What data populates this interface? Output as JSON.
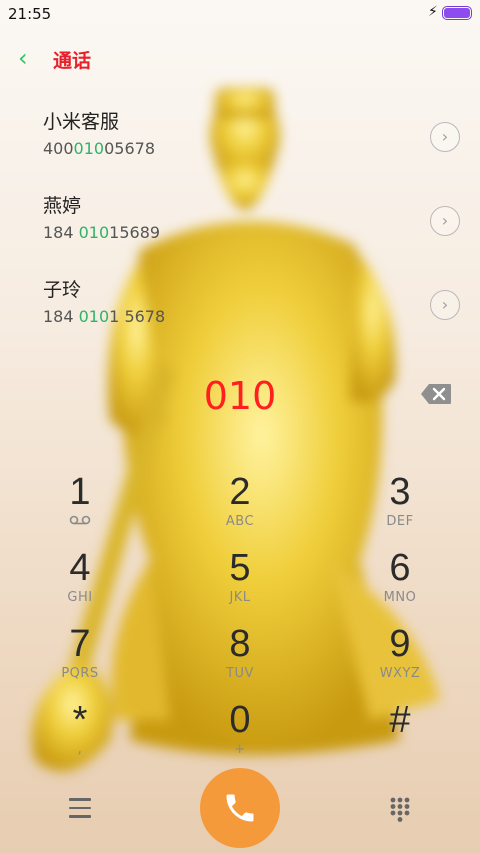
{
  "status": {
    "time": "21:55",
    "charging_icon": "bolt-icon",
    "battery_color": "#8e4cf0"
  },
  "header": {
    "title": "通话",
    "back_icon": "chevron-left-icon"
  },
  "contacts": [
    {
      "name": "小米客服",
      "number_pre": "400",
      "number_match": "010",
      "number_post": "05678"
    },
    {
      "name": "燕婷",
      "number_pre": "184 ",
      "number_match": "010",
      "number_post": "15689"
    },
    {
      "name": "子玲",
      "number_pre": "184 ",
      "number_match": "010",
      "number_post": "1 5678"
    }
  ],
  "dialed": "010",
  "keypad": [
    {
      "digit": "1",
      "letters": "voicemail-icon"
    },
    {
      "digit": "2",
      "letters": "ABC"
    },
    {
      "digit": "3",
      "letters": "DEF"
    },
    {
      "digit": "4",
      "letters": "GHI"
    },
    {
      "digit": "5",
      "letters": "JKL"
    },
    {
      "digit": "6",
      "letters": "MNO"
    },
    {
      "digit": "7",
      "letters": "PQRS"
    },
    {
      "digit": "8",
      "letters": "TUV"
    },
    {
      "digit": "9",
      "letters": "WXYZ"
    },
    {
      "digit": "*",
      "letters": ","
    },
    {
      "digit": "0",
      "letters": "+"
    },
    {
      "digit": "#",
      "letters": ""
    }
  ],
  "colors": {
    "accent": "#e8202a",
    "match": "#2fb26a",
    "call": "#f59a3a",
    "dialed": "#ff1f1f"
  }
}
